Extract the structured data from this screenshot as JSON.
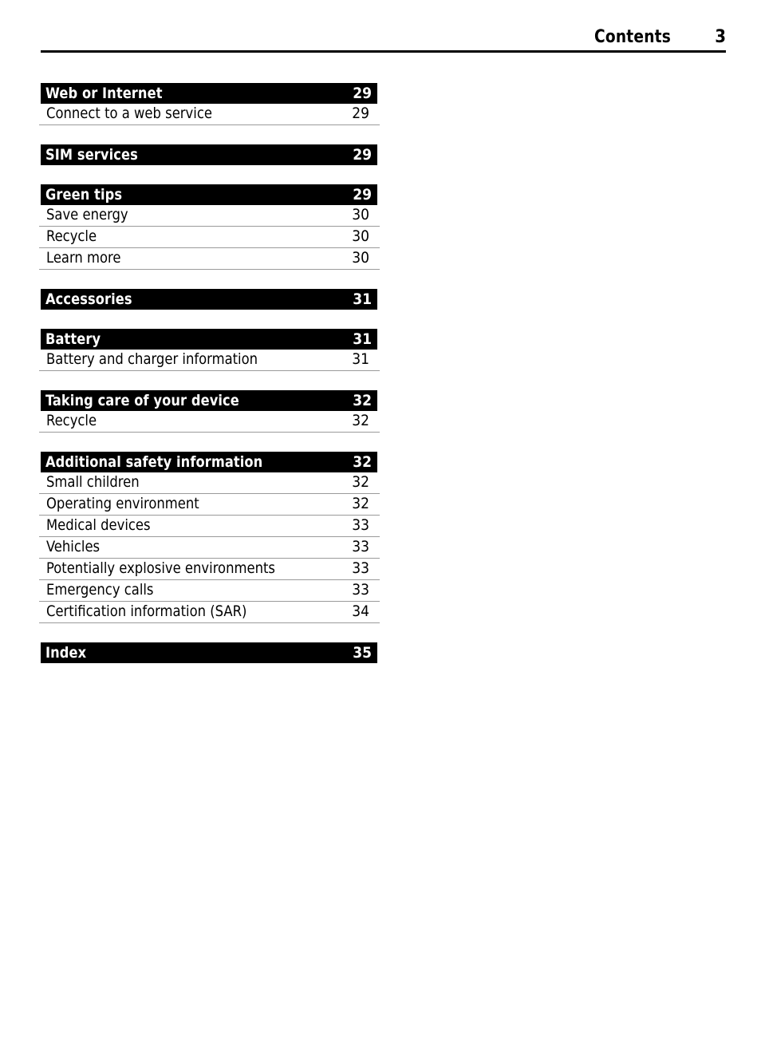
{
  "header": {
    "title": "Contents",
    "page_number": "3"
  },
  "toc": {
    "sections": [
      {
        "heading": "Web or Internet",
        "heading_page": "29",
        "entries": [
          {
            "label": "Connect to a web service",
            "page": "29"
          }
        ]
      },
      {
        "heading": "SIM services",
        "heading_page": "29",
        "entries": []
      },
      {
        "heading": "Green tips",
        "heading_page": "29",
        "entries": [
          {
            "label": "Save energy",
            "page": "30"
          },
          {
            "label": "Recycle",
            "page": "30"
          },
          {
            "label": "Learn more",
            "page": "30"
          }
        ]
      },
      {
        "heading": "Accessories",
        "heading_page": "31",
        "entries": []
      },
      {
        "heading": "Battery",
        "heading_page": "31",
        "entries": [
          {
            "label": "Battery and charger information",
            "page": "31"
          }
        ]
      },
      {
        "heading": "Taking care of your device",
        "heading_page": "32",
        "entries": [
          {
            "label": "Recycle",
            "page": "32"
          }
        ]
      },
      {
        "heading": "Additional safety information",
        "heading_page": "32",
        "entries": [
          {
            "label": "Small children",
            "page": "32"
          },
          {
            "label": "Operating environment",
            "page": "32"
          },
          {
            "label": "Medical devices",
            "page": "33"
          },
          {
            "label": "Vehicles",
            "page": "33"
          },
          {
            "label": "Potentially explosive environments",
            "page": "33"
          },
          {
            "label": "Emergency calls",
            "page": "33"
          },
          {
            "label": "Certification information (SAR)",
            "page": "34"
          }
        ]
      },
      {
        "heading": "Index",
        "heading_page": "35",
        "entries": []
      }
    ]
  }
}
